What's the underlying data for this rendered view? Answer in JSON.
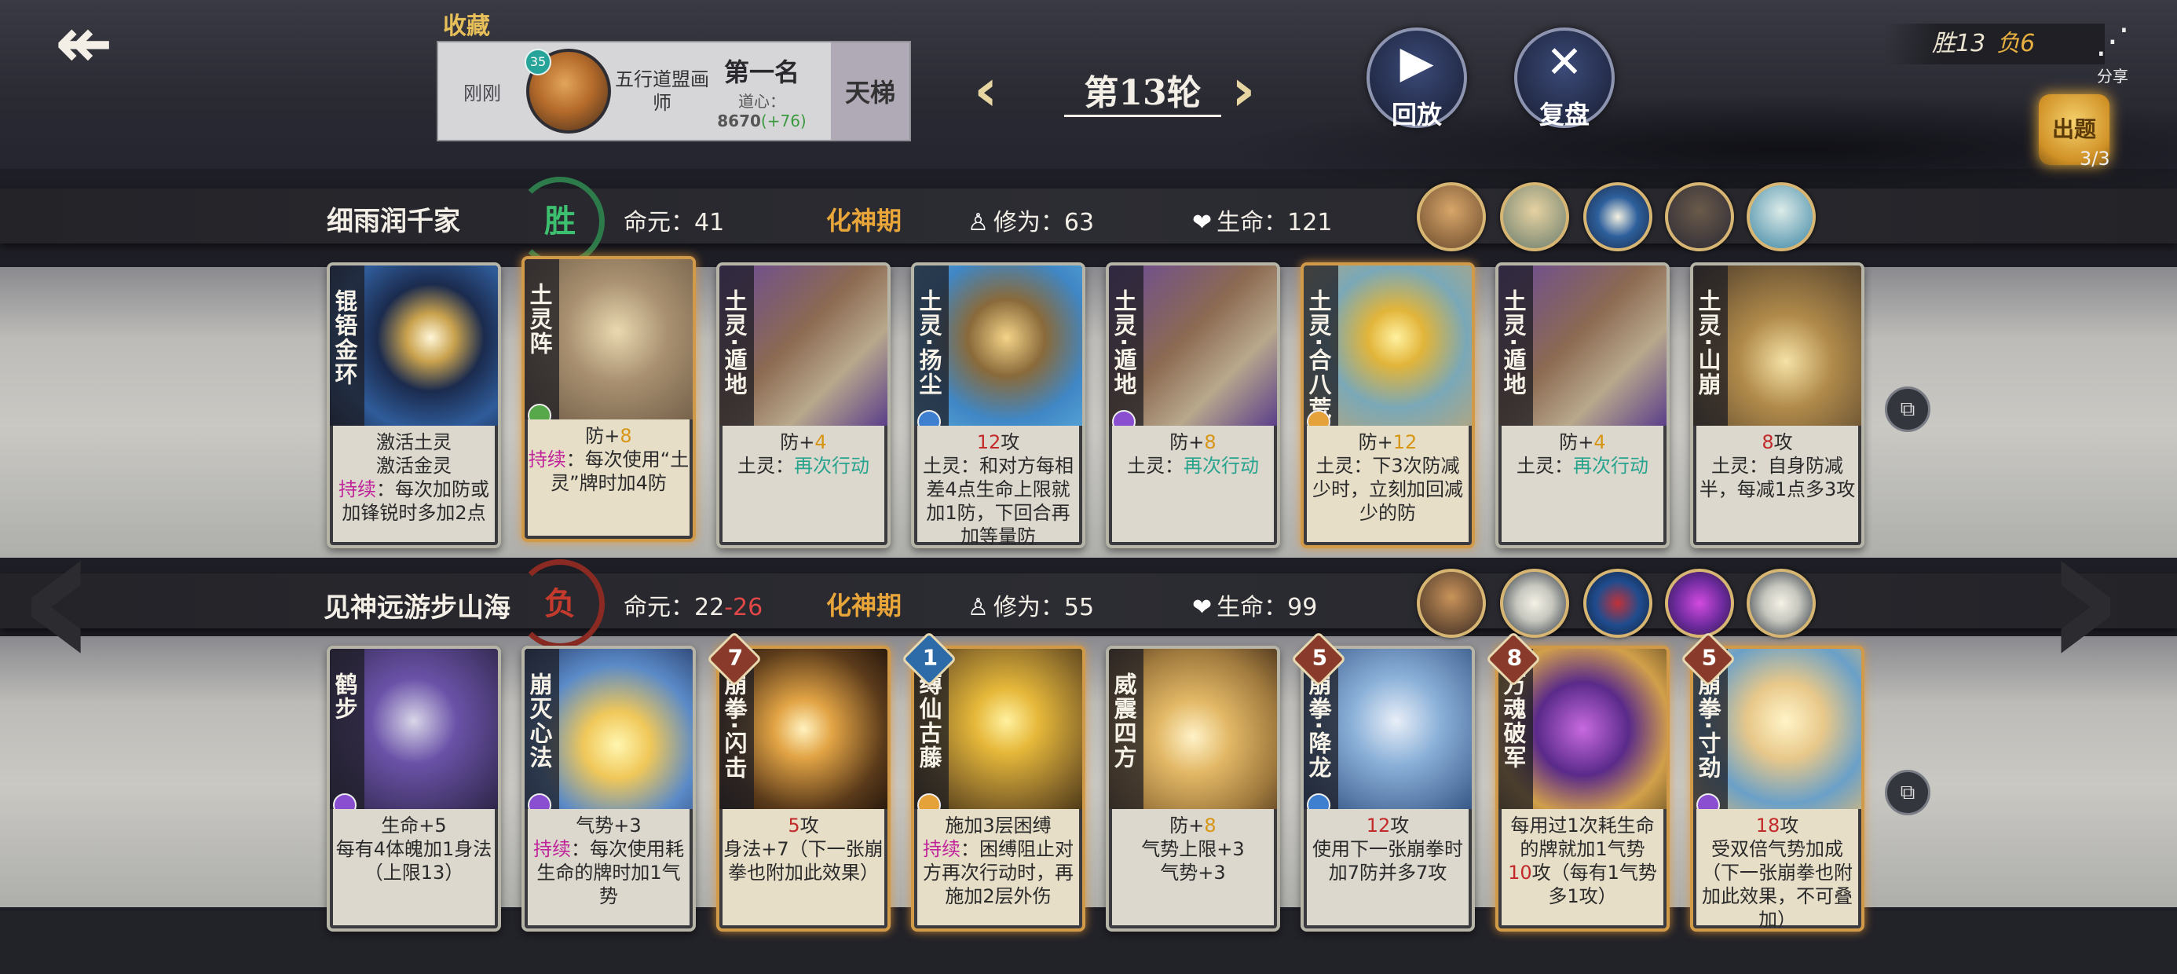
{
  "header": {
    "collect_label": "收藏",
    "player_card": {
      "prev_label": "刚刚",
      "badge": "35",
      "title": "五行道盟画师",
      "rank": "第一名",
      "dao_label": "道心：",
      "dao_value": "8670",
      "dao_delta": "(+76)",
      "ladder": "天梯"
    },
    "round_label": "第13轮",
    "replay_label": "回放",
    "review_label": "复盘",
    "record": {
      "win": "胜13",
      "lose": "负6"
    },
    "share_label": "分享",
    "quiz_label": "出题",
    "quiz_count": "3/3"
  },
  "players": [
    {
      "name": "细雨润千家",
      "result": "胜",
      "mingyuan_label": "命元：",
      "mingyuan": "41",
      "mingyuan_delta": "",
      "realm": "化神期",
      "xiuwei_label": "修为：",
      "xiuwei": "63",
      "life_label": "生命：",
      "life": "121",
      "cards": [
        {
          "title": "锟铻金环",
          "desc_html": "激活土灵<br>激活金灵<br><span class='mag'>持续</span>：每次加防或加锋锐时多加2点"
        },
        {
          "title": "土灵阵",
          "desc_html": "防+<span class='yel'>8</span><br><span class='mag'>持续</span>：每次使用“土灵”牌时加4防"
        },
        {
          "title": "土灵·遁地",
          "desc_html": "防+<span class='yel'>4</span><br>土灵：<span class='teal'>再次行动</span>"
        },
        {
          "title": "土灵·扬尘",
          "desc_html": "<span class='red'>12</span>攻<br>土灵：和对方每相差4点生命上限就加1防，下回合再加等量防"
        },
        {
          "title": "土灵·遁地",
          "desc_html": "防+<span class='yel'>8</span><br>土灵：<span class='teal'>再次行动</span>"
        },
        {
          "title": "土灵·合八荒",
          "desc_html": "防+<span class='yel'>12</span><br>土灵：下3次防减少时，立刻加回减少的防"
        },
        {
          "title": "土灵·遁地",
          "desc_html": "防+<span class='yel'>4</span><br>土灵：<span class='teal'>再次行动</span>"
        },
        {
          "title": "土灵·山崩",
          "desc_html": "<span class='red'>8</span>攻<br>土灵：自身防减半，每减1点多3攻"
        }
      ]
    },
    {
      "name": "见神远游步山海",
      "result": "负",
      "mingyuan_label": "命元：",
      "mingyuan": "22",
      "mingyuan_delta": "-26",
      "realm": "化神期",
      "xiuwei_label": "修为：",
      "xiuwei": "55",
      "life_label": "生命：",
      "life": "99",
      "cards": [
        {
          "title": "鹤步",
          "cost": "",
          "desc_html": "生命+5<br>每有4体魄加1身法（上限13）"
        },
        {
          "title": "崩灭心法",
          "cost": "",
          "desc_html": "气势+3<br><span class='mag'>持续</span>：每次使用耗生命的牌时加1气势"
        },
        {
          "title": "崩拳·闪击",
          "cost": "7",
          "desc_html": "<span class='red'>5</span>攻<br>身法+7（下一张崩拳也附加此效果）"
        },
        {
          "title": "缚仙古藤",
          "cost": "1",
          "desc_html": "施加3层困缚<br><span class='mag'>持续</span>：困缚阻止对方再次行动时，再施加2层外伤"
        },
        {
          "title": "威震四方",
          "cost": "",
          "desc_html": "防+<span class='yel'>8</span><br>气势上限+3<br>气势+3"
        },
        {
          "title": "崩拳·降龙",
          "cost": "5",
          "desc_html": "<span class='red'>12</span>攻<br>使用下一张崩拳时加7防并多7攻"
        },
        {
          "title": "万魂破军",
          "cost": "8",
          "desc_html": "每用过1次耗生命的牌就加1气势<br><span class='red'>10</span>攻（每有1气势多1攻）"
        },
        {
          "title": "崩拳·寸劲",
          "cost": "5",
          "desc_html": "<span class='red'>18</span>攻<br>受双倍气势加成（下一张崩拳也附加此效果，不可叠加）"
        }
      ]
    }
  ],
  "colors": {
    "accent_gold": "#e8a63a",
    "win_green": "#3cbf6e",
    "lose_red": "#c43a2c",
    "attack_red": "#c22a2a",
    "defense_yellow": "#d79515",
    "persist_magenta": "#c0249a",
    "again_teal": "#28a38e"
  },
  "icons": {
    "back": "double-arrow-left-icon",
    "replay": "play-icon",
    "review": "cross-swords-icon",
    "share": "share-icon",
    "copy": "copy-deck-icon",
    "xiuwei": "meditation-icon",
    "life": "heart-icon"
  }
}
